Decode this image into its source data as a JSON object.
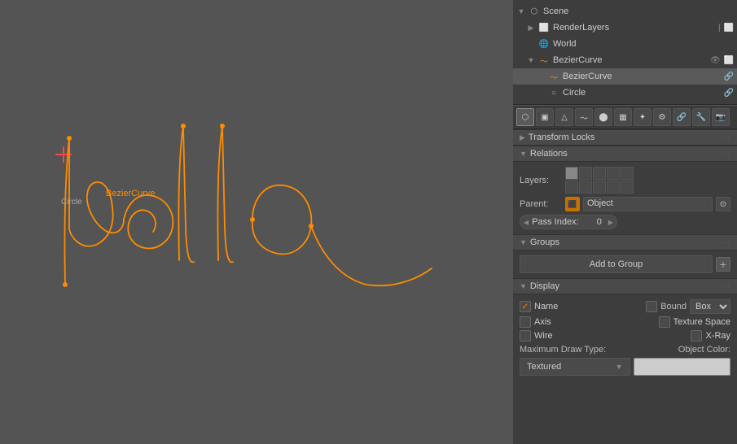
{
  "viewport": {
    "bg_color": "#545454",
    "curve_label": "BezierCurve",
    "circle_label": "Circle"
  },
  "scene_tree": {
    "title": "Scene",
    "items": [
      {
        "id": "scene",
        "label": "Scene",
        "indent": 0,
        "icon": "scene",
        "expanded": true
      },
      {
        "id": "render_layers",
        "label": "RenderLayers",
        "indent": 1,
        "icon": "render",
        "expanded": false
      },
      {
        "id": "world",
        "label": "World",
        "indent": 1,
        "icon": "world",
        "expanded": false
      },
      {
        "id": "bezier_curve_parent",
        "label": "BezierCurve",
        "indent": 1,
        "icon": "curve",
        "expanded": true
      },
      {
        "id": "bezier_curve_child",
        "label": "BezierCurve",
        "indent": 2,
        "icon": "curve",
        "expanded": false
      },
      {
        "id": "circle",
        "label": "Circle",
        "indent": 2,
        "icon": "circle",
        "expanded": false
      }
    ]
  },
  "toolbar": {
    "buttons": [
      "obj",
      "mesh",
      "curve",
      "surf",
      "meta",
      "font",
      "arm",
      "lat",
      "cam",
      "lamp",
      "force",
      "spk",
      "cns",
      "mod",
      "data",
      "mat",
      "tex",
      "part",
      "phy"
    ]
  },
  "sections": {
    "transform_locks": {
      "label": "Transform Locks"
    },
    "relations": {
      "label": "Relations"
    },
    "groups": {
      "label": "Groups"
    },
    "display": {
      "label": "Display"
    }
  },
  "relations": {
    "layers_label": "Layers:",
    "parent_label": "Parent:",
    "parent_value": "Object",
    "pass_index_label": "Pass Index:",
    "pass_index_value": "0"
  },
  "groups": {
    "add_button": "Add to Group",
    "plus_icon": "+"
  },
  "display": {
    "name_label": "Name",
    "name_checked": true,
    "bound_label": "Bound",
    "bound_value": "Box",
    "axis_label": "Axis",
    "axis_checked": false,
    "texture_space_label": "Texture Space",
    "texture_space_checked": false,
    "wire_label": "Wire",
    "wire_checked": false,
    "x_ray_label": "X-Ray",
    "x_ray_checked": false,
    "max_draw_type_label": "Maximum Draw Type:",
    "max_draw_value": "Textured",
    "object_color_label": "Object Color:"
  }
}
